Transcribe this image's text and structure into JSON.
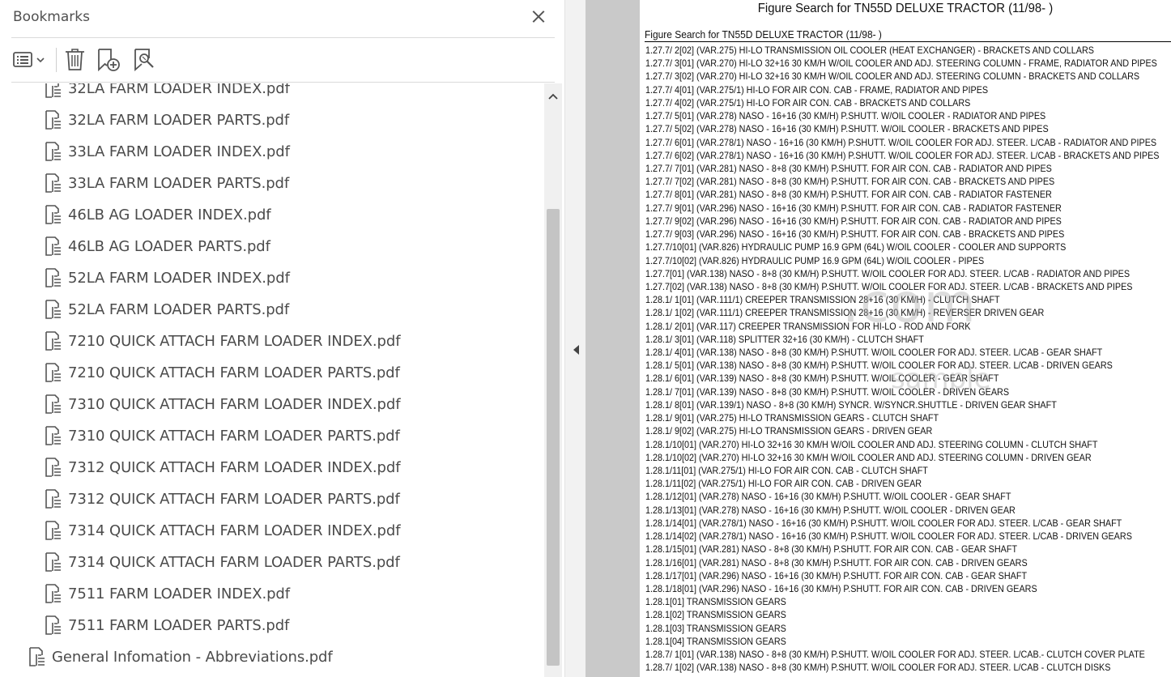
{
  "bookmarks": {
    "title": "Bookmarks",
    "toolbar": {
      "options_icon": "list-options-icon",
      "delete_icon": "trash-icon",
      "new_bookmark_icon": "new-bookmark-icon",
      "find_bookmark_icon": "find-current-bookmark-icon"
    },
    "items": [
      {
        "label": "32LA FARM LOADER INDEX.pdf"
      },
      {
        "label": "32LA FARM LOADER PARTS.pdf"
      },
      {
        "label": "33LA FARM LOADER INDEX.pdf"
      },
      {
        "label": "33LA FARM LOADER PARTS.pdf"
      },
      {
        "label": "46LB AG LOADER INDEX.pdf"
      },
      {
        "label": "46LB AG LOADER PARTS.pdf"
      },
      {
        "label": "52LA FARM LOADER INDEX.pdf"
      },
      {
        "label": "52LA FARM LOADER PARTS.pdf"
      },
      {
        "label": "7210 QUICK ATTACH FARM LOADER INDEX.pdf"
      },
      {
        "label": "7210 QUICK ATTACH FARM LOADER PARTS.pdf"
      },
      {
        "label": "7310 QUICK ATTACH FARM LOADER INDEX.pdf"
      },
      {
        "label": "7310 QUICK ATTACH FARM LOADER PARTS.pdf"
      },
      {
        "label": "7312 QUICK ATTACH FARM LOADER INDEX.pdf"
      },
      {
        "label": "7312 QUICK ATTACH FARM LOADER PARTS.pdf"
      },
      {
        "label": "7314 QUICK ATTACH FARM LOADER INDEX.pdf"
      },
      {
        "label": "7314 QUICK ATTACH FARM LOADER PARTS.pdf"
      },
      {
        "label": "7511 FARM LOADER INDEX.pdf"
      },
      {
        "label": "7511 FARM LOADER PARTS.pdf"
      },
      {
        "label": "General Infomation - Abbreviations.pdf"
      }
    ]
  },
  "document": {
    "heading": "Figure Search for TN55D DELUXE TRACTOR (11/98- )",
    "subheading": "Figure Search for TN55D DELUXE TRACTOR (11/98- )",
    "lines": [
      "1.27.7/ 2[02] (VAR.275) HI-LO TRANSMISSION OIL COOLER (HEAT EXCHANGER) - BRACKETS AND COLLARS",
      "1.27.7/ 3[01] (VAR.270) HI-LO 32+16 30 KM/H W/OIL COOLER AND ADJ. STEERING COLUMN - FRAME, RADIATOR AND PIPES",
      "1.27.7/ 3[02] (VAR.270) HI-LO 32+16 30 KM/H W/OIL COOLER AND ADJ. STEERING COLUMN - BRACKETS AND COLLARS",
      "1.27.7/ 4[01] (VAR.275/1) HI-LO FOR AIR CON. CAB - FRAME, RADIATOR AND PIPES",
      "1.27.7/ 4[02] (VAR.275/1) HI-LO FOR AIR CON. CAB - BRACKETS AND COLLARS",
      "1.27.7/ 5[01] (VAR.278) NASO - 16+16 (30 KM/H) P.SHUTT. W/OIL COOLER - RADIATOR AND PIPES",
      "1.27.7/ 5[02] (VAR.278) NASO - 16+16 (30 KM/H) P.SHUTT. W/OIL COOLER - BRACKETS AND PIPES",
      "1.27.7/ 6[01] (VAR.278/1) NASO - 16+16 (30 KM/H) P.SHUTT. W/OIL COOLER FOR ADJ. STEER. L/CAB - RADIATOR AND PIPES",
      "1.27.7/ 6[02] (VAR.278/1) NASO - 16+16 (30 KM/H) P.SHUTT. W/OIL COOLER FOR ADJ. STEER. L/CAB - BRACKETS AND PIPES",
      "1.27.7/ 7[01] (VAR.281) NASO - 8+8 (30 KM/H) P.SHUTT. FOR AIR CON. CAB - RADIATOR AND PIPES",
      "1.27.7/ 7[02] (VAR.281) NASO - 8+8 (30 KM/H) P.SHUTT. FOR AIR CON. CAB - BRACKETS AND PIPES",
      "1.27.7/ 8[01] (VAR.281) NASO - 8+8 (30 KM/H) P.SHUTT. FOR AIR CON. CAB - RADIATOR FASTENER",
      "1.27.7/ 9[01] (VAR.296) NASO - 16+16 (30 KM/H) P.SHUTT. FOR AIR CON. CAB - RADIATOR FASTENER",
      "1.27.7/ 9[02] (VAR.296) NASO - 16+16 (30 KM/H) P.SHUTT. FOR AIR CON. CAB - RADIATOR AND PIPES",
      "1.27.7/ 9[03] (VAR.296) NASO - 16+16 (30 KM/H) P.SHUTT. FOR AIR CON. CAB - BRACKETS AND PIPES",
      "1.27.7/10[01] (VAR.826) HYDRAULIC PUMP 16.9 GPM (64L) W/OIL COOLER - COOLER AND SUPPORTS",
      "1.27.7/10[02] (VAR.826) HYDRAULIC PUMP 16.9 GPM (64L) W/OIL COOLER - PIPES",
      "1.27.7[01] (VAR.138) NASO - 8+8 (30 KM/H) P.SHUTT. W/OIL COOLER FOR ADJ. STEER. L/CAB - RADIATOR AND PIPES",
      "1.27.7[02] (VAR.138) NASO - 8+8 (30 KM/H) P.SHUTT. W/OIL COOLER FOR ADJ. STEER. L/CAB - BRACKETS AND PIPES",
      "1.28.1/ 1[01] (VAR.111/1) CREEPER TRANSMISSION 28+16 (30 KM/H) - CLUTCH SHAFT",
      "1.28.1/ 1[02] (VAR.111/1) CREEPER TRANSMISSION 28+16 (30 KM/H) - REVERSER DRIVEN GEAR",
      "1.28.1/ 2[01] (VAR.117) CREEPER TRANSMISSION FOR HI-LO - ROD AND FORK",
      "1.28.1/ 3[01] (VAR.118) SPLITTER 32+16 (30 KM/H) - CLUTCH SHAFT",
      "1.28.1/ 4[01] (VAR.138) NASO - 8+8 (30 KM/H) P.SHUTT. W/OIL COOLER FOR ADJ. STEER. L/CAB - GEAR SHAFT",
      "1.28.1/ 5[01] (VAR.138) NASO - 8+8 (30 KM/H) P.SHUTT. W/OIL COOLER FOR ADJ. STEER. L/CAB - DRIVEN GEARS",
      "1.28.1/ 6[01] (VAR.139) NASO - 8+8 (30 KM/H) P.SHUTT. W/OIL COOLER - GEAR SHAFT",
      "1.28.1/ 7[01] (VAR.139) NASO - 8+8 (30 KM/H) P.SHUTT. W/OIL COOLER - DRIVEN GEARS",
      "1.28.1/ 8[01] (VAR.139/1) NASO - 8+8 (30 KM/H) SYNCR. W/SYNCR.SHUTTLE - DRIVEN GEAR SHAFT",
      "1.28.1/ 9[01] (VAR.275) HI-LO TRANSMISSION GEARS - CLUTCH SHAFT",
      "1.28.1/ 9[02] (VAR.275) HI-LO TRANSMISSION GEARS - DRIVEN GEAR",
      "1.28.1/10[01] (VAR.270) HI-LO 32+16 30 KM/H W/OIL COOLER AND ADJ. STEERING COLUMN - CLUTCH SHAFT",
      "1.28.1/10[02] (VAR.270) HI-LO 32+16 30 KM/H W/OIL COOLER AND ADJ. STEERING COLUMN - DRIVEN GEAR",
      "1.28.1/11[01] (VAR.275/1) HI-LO FOR AIR CON. CAB - CLUTCH SHAFT",
      "1.28.1/11[02] (VAR.275/1) HI-LO FOR AIR CON. CAB - DRIVEN GEAR",
      "1.28.1/12[01] (VAR.278) NASO - 16+16 (30 KM/H) P.SHUTT. W/OIL COOLER - GEAR SHAFT",
      "1.28.1/13[01] (VAR.278) NASO - 16+16 (30 KM/H) P.SHUTT. W/OIL COOLER - DRIVEN GEAR",
      "1.28.1/14[01] (VAR.278/1) NASO - 16+16 (30 KM/H) P.SHUTT. W/OIL COOLER FOR ADJ. STEER. L/CAB - GEAR SHAFT",
      "1.28.1/14[02] (VAR.278/1) NASO - 16+16 (30 KM/H) P.SHUTT. W/OIL COOLER FOR ADJ. STEER. L/CAB - DRIVEN GEARS",
      "1.28.1/15[01] (VAR.281) NASO - 8+8 (30 KM/H) P.SHUTT. FOR AIR CON. CAB - GEAR SHAFT",
      "1.28.1/16[01] (VAR.281) NASO - 8+8 (30 KM/H) P.SHUTT. FOR AIR CON. CAB - DRIVEN GEARS",
      "1.28.1/17[01] (VAR.296) NASO - 16+16 (30 KM/H) P.SHUTT. FOR AIR CON. CAB - GEAR SHAFT",
      "1.28.1/18[01] (VAR.296) NASO - 16+16 (30 KM/H) P.SHUTT. FOR AIR CON. CAB - DRIVEN GEARS",
      "1.28.1[01] TRANSMISSION GEARS",
      "1.28.1[02] TRANSMISSION GEARS",
      "1.28.1[03] TRANSMISSION GEARS",
      "1.28.1[04] TRANSMISSION GEARS",
      "1.28.7/ 1[01] (VAR.138) NASO - 8+8 (30 KM/H) P.SHUTT. W/OIL COOLER FOR ADJ. STEER. L/CAB.- CLUTCH COVER PLATE",
      "1.28.7/ 1[02] (VAR.138) NASO - 8+8 (30 KM/H) P.SHUTT. W/OIL COOLER FOR ADJ. STEER. L/CAB - CLUTCH DISKS"
    ]
  },
  "watermark": {
    "line1": ".com",
    "line2": "sample"
  },
  "colors": {
    "panel_bg": "#ffffff",
    "gutter": "#c9c9c9",
    "label_text": "#4b4b4b",
    "icon_gray": "#555555",
    "scroll_thumb": "#c4c4c4"
  }
}
